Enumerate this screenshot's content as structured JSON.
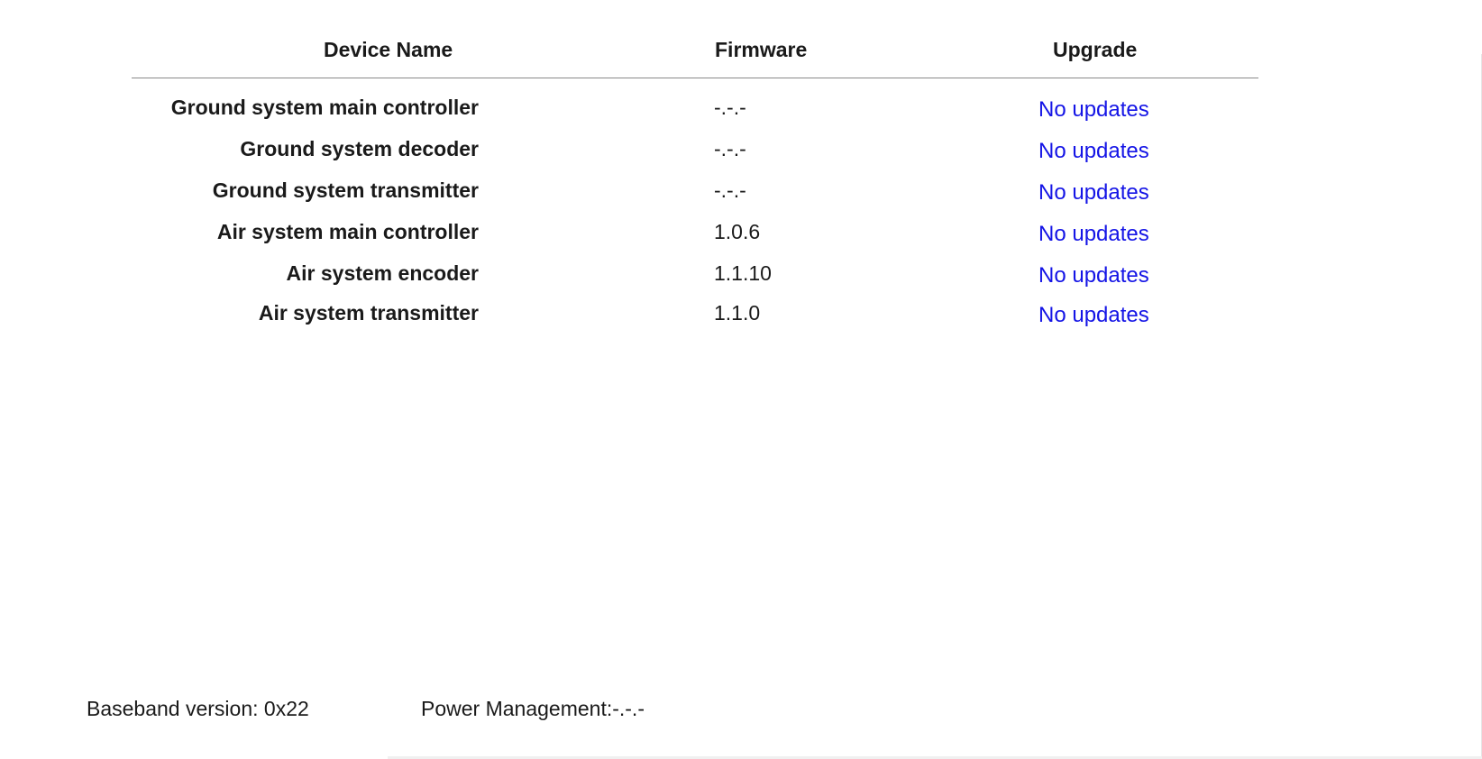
{
  "table": {
    "headers": {
      "device_name": "Device Name",
      "firmware": "Firmware",
      "upgrade": "Upgrade"
    },
    "rows": [
      {
        "device": "Ground system main controller",
        "firmware": "-.-.-",
        "upgrade": "No updates"
      },
      {
        "device": "Ground system decoder",
        "firmware": "-.-.-",
        "upgrade": "No updates"
      },
      {
        "device": "Ground system transmitter",
        "firmware": "-.-.-",
        "upgrade": "No updates"
      },
      {
        "device": "Air system main controller",
        "firmware": "1.0.6",
        "upgrade": "No updates"
      },
      {
        "device": "Air system encoder",
        "firmware": "1.1.10",
        "upgrade": "No updates"
      },
      {
        "device": "Air system transmitter",
        "firmware": "1.1.0",
        "upgrade": "No updates"
      }
    ]
  },
  "footer": {
    "baseband": "Baseband version: 0x22",
    "power_management": "Power Management:-.-.-"
  },
  "colors": {
    "link": "#1414e6",
    "text": "#1a1a1a",
    "divider": "#8a8a8a"
  }
}
